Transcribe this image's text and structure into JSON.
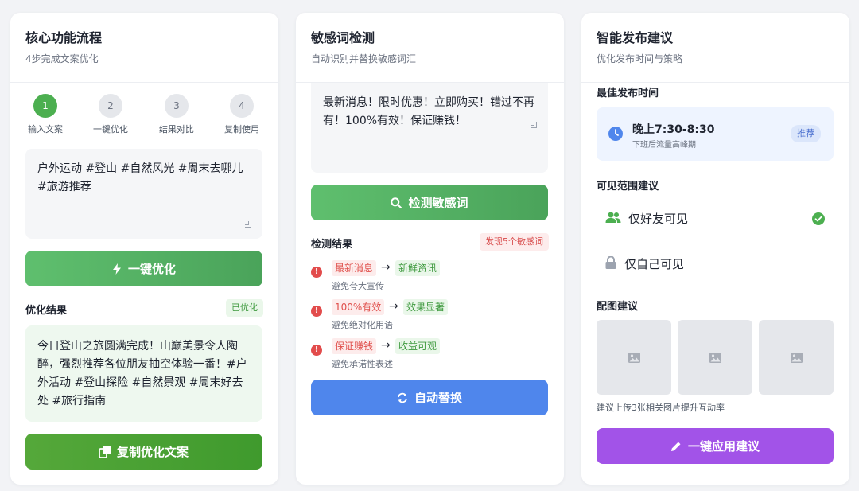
{
  "colors": {
    "green": "#4caf50",
    "blue": "#4f86ec",
    "purple": "#a253e8",
    "red": "#e24c4c"
  },
  "card1": {
    "title": "核心功能流程",
    "subtitle": "4步完成文案优化",
    "steps": [
      {
        "number": "1",
        "label": "输入文案",
        "active": true
      },
      {
        "number": "2",
        "label": "一键优化",
        "active": false
      },
      {
        "number": "3",
        "label": "结果对比",
        "active": false
      },
      {
        "number": "4",
        "label": "复制使用",
        "active": false
      }
    ],
    "input_text": "户外运动 #登山 #自然风光 #周末去哪儿 #旅游推荐",
    "optimize_button": "一键优化",
    "optimize_icon": "lightning-icon",
    "result_label": "优化结果",
    "result_badge": "已优化",
    "result_text": "今日登山之旅圆满完成！山巅美景令人陶醉，强烈推荐各位朋友抽空体验一番！#户外活动 #登山探险 #自然景观 #周末好去处 #旅行指南",
    "copy_button": "复制优化文案",
    "copy_icon": "copy-icon"
  },
  "card2": {
    "title": "敏感词检测",
    "subtitle": "自动识别并替换敏感词汇",
    "input_text": "最新消息！限时优惠！立即购买！错过不再有！100%有效！保证赚钱！",
    "detect_button": "检测敏感词",
    "detect_icon": "search-icon",
    "result_label": "检测结果",
    "found_badge": "发现5个敏感词",
    "items": [
      {
        "bad": "最新消息",
        "arrow": "→",
        "good": "新鲜资讯",
        "note": "避免夸大宣传"
      },
      {
        "bad": "100%有效",
        "arrow": "→",
        "good": "效果显著",
        "note": "避免绝对化用语"
      },
      {
        "bad": "保证赚钱",
        "arrow": "→",
        "good": "收益可观",
        "note": "避免承诺性表述"
      }
    ],
    "replace_button": "自动替换",
    "replace_icon": "sync-icon"
  },
  "card3": {
    "title": "智能发布建议",
    "subtitle": "优化发布时间与策略",
    "best_time_label": "最佳发布时间",
    "time_main": "晚上7:30-8:30",
    "time_sub": "下班后流量高峰期",
    "time_badge": "推荐",
    "visibility_label": "可见范围建议",
    "visibility_options": [
      {
        "label": "仅好友可见",
        "icon": "friends-icon",
        "selected": true
      },
      {
        "label": "仅自己可见",
        "icon": "lock-icon",
        "selected": false
      }
    ],
    "image_label": "配图建议",
    "image_hint": "建议上传3张相关图片提升互动率",
    "apply_button": "一键应用建议",
    "apply_icon": "pencil-icon"
  }
}
